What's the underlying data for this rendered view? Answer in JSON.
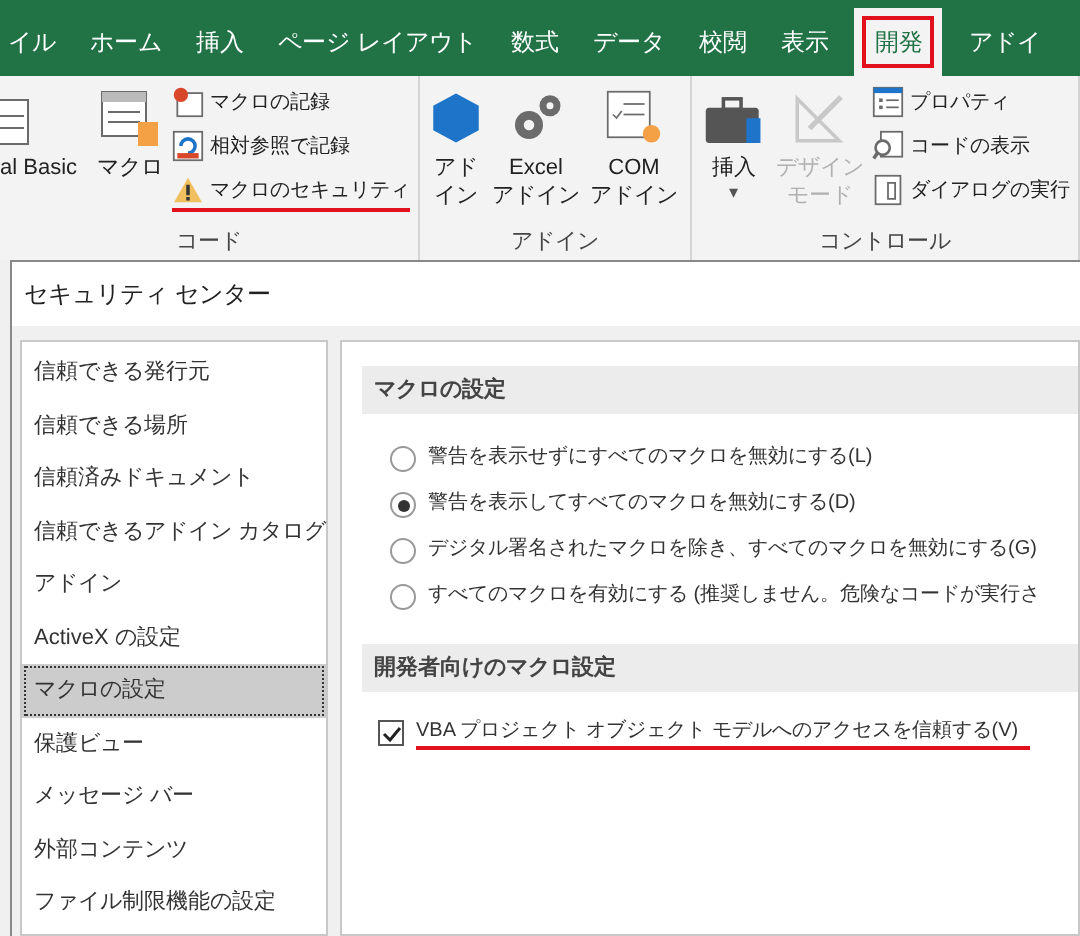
{
  "ribbon_tabs": [
    {
      "label": "イル",
      "selected": false,
      "highlighted": false
    },
    {
      "label": "ホーム",
      "selected": false,
      "highlighted": false
    },
    {
      "label": "挿入",
      "selected": false,
      "highlighted": false
    },
    {
      "label": "ページ レイアウト",
      "selected": false,
      "highlighted": false
    },
    {
      "label": "数式",
      "selected": false,
      "highlighted": false
    },
    {
      "label": "データ",
      "selected": false,
      "highlighted": false
    },
    {
      "label": "校閲",
      "selected": false,
      "highlighted": false
    },
    {
      "label": "表示",
      "selected": false,
      "highlighted": false
    },
    {
      "label": "開発",
      "selected": true,
      "highlighted": true
    },
    {
      "label": "アドイ",
      "selected": false,
      "highlighted": false
    }
  ],
  "ribbon_groups": [
    {
      "label": "コード",
      "items": [
        {
          "kind": "large",
          "label": "al Basic",
          "disabled": false
        },
        {
          "kind": "large",
          "label": "マクロ",
          "disabled": false
        },
        {
          "kind": "stack",
          "buttons": [
            {
              "label": "マクロの記録",
              "highlighted": false
            },
            {
              "label": "相対参照で記録",
              "highlighted": false
            },
            {
              "label": "マクロのセキュリティ",
              "highlighted": true
            }
          ]
        }
      ]
    },
    {
      "label": "アドイン",
      "items": [
        {
          "kind": "large",
          "label": "アドイン",
          "disabled": false
        },
        {
          "kind": "large",
          "label": "Excel アドイン",
          "disabled": false
        },
        {
          "kind": "large",
          "label": "COM アドイン",
          "disabled": false
        }
      ]
    },
    {
      "label": "コントロール",
      "items": [
        {
          "kind": "large",
          "label": "挿入",
          "caret": "▾",
          "disabled": false
        },
        {
          "kind": "large",
          "label": "デザインモード",
          "disabled": true
        },
        {
          "kind": "stack",
          "buttons": [
            {
              "label": "プロパティ",
              "highlighted": false
            },
            {
              "label": "コードの表示",
              "highlighted": false
            },
            {
              "label": "ダイアログの実行",
              "highlighted": false
            }
          ]
        }
      ]
    }
  ],
  "dialog": {
    "title": "セキュリティ センター",
    "nav": [
      {
        "label": "信頼できる発行元",
        "selected": false
      },
      {
        "label": "信頼できる場所",
        "selected": false
      },
      {
        "label": "信頼済みドキュメント",
        "selected": false
      },
      {
        "label": "信頼できるアドイン カタログ",
        "selected": false
      },
      {
        "label": "アドイン",
        "selected": false
      },
      {
        "label": "ActiveX の設定",
        "selected": false
      },
      {
        "label": "マクロの設定",
        "selected": true
      },
      {
        "label": "保護ビュー",
        "selected": false
      },
      {
        "label": "メッセージ バー",
        "selected": false
      },
      {
        "label": "外部コンテンツ",
        "selected": false
      },
      {
        "label": "ファイル制限機能の設定",
        "selected": false
      }
    ],
    "sections": [
      {
        "title": "マクロの設定",
        "options": [
          {
            "kind": "radio",
            "label": "警告を表示せずにすべてのマクロを無効にする(L)",
            "selected": false,
            "highlighted": false
          },
          {
            "kind": "radio",
            "label": "警告を表示してすべてのマクロを無効にする(D)",
            "selected": true,
            "highlighted": false
          },
          {
            "kind": "radio",
            "label": "デジタル署名されたマクロを除き、すべてのマクロを無効にする(G)",
            "selected": false,
            "highlighted": false
          },
          {
            "kind": "radio",
            "label": "すべてのマクロを有効にする (推奨しません。危険なコードが実行さ",
            "selected": false,
            "highlighted": false
          }
        ]
      },
      {
        "title": "開発者向けのマクロ設定",
        "options": [
          {
            "kind": "checkbox",
            "label": "VBA プロジェクト オブジェクト モデルへのアクセスを信頼する(V)",
            "checked": true,
            "highlighted": true
          }
        ]
      }
    ]
  }
}
